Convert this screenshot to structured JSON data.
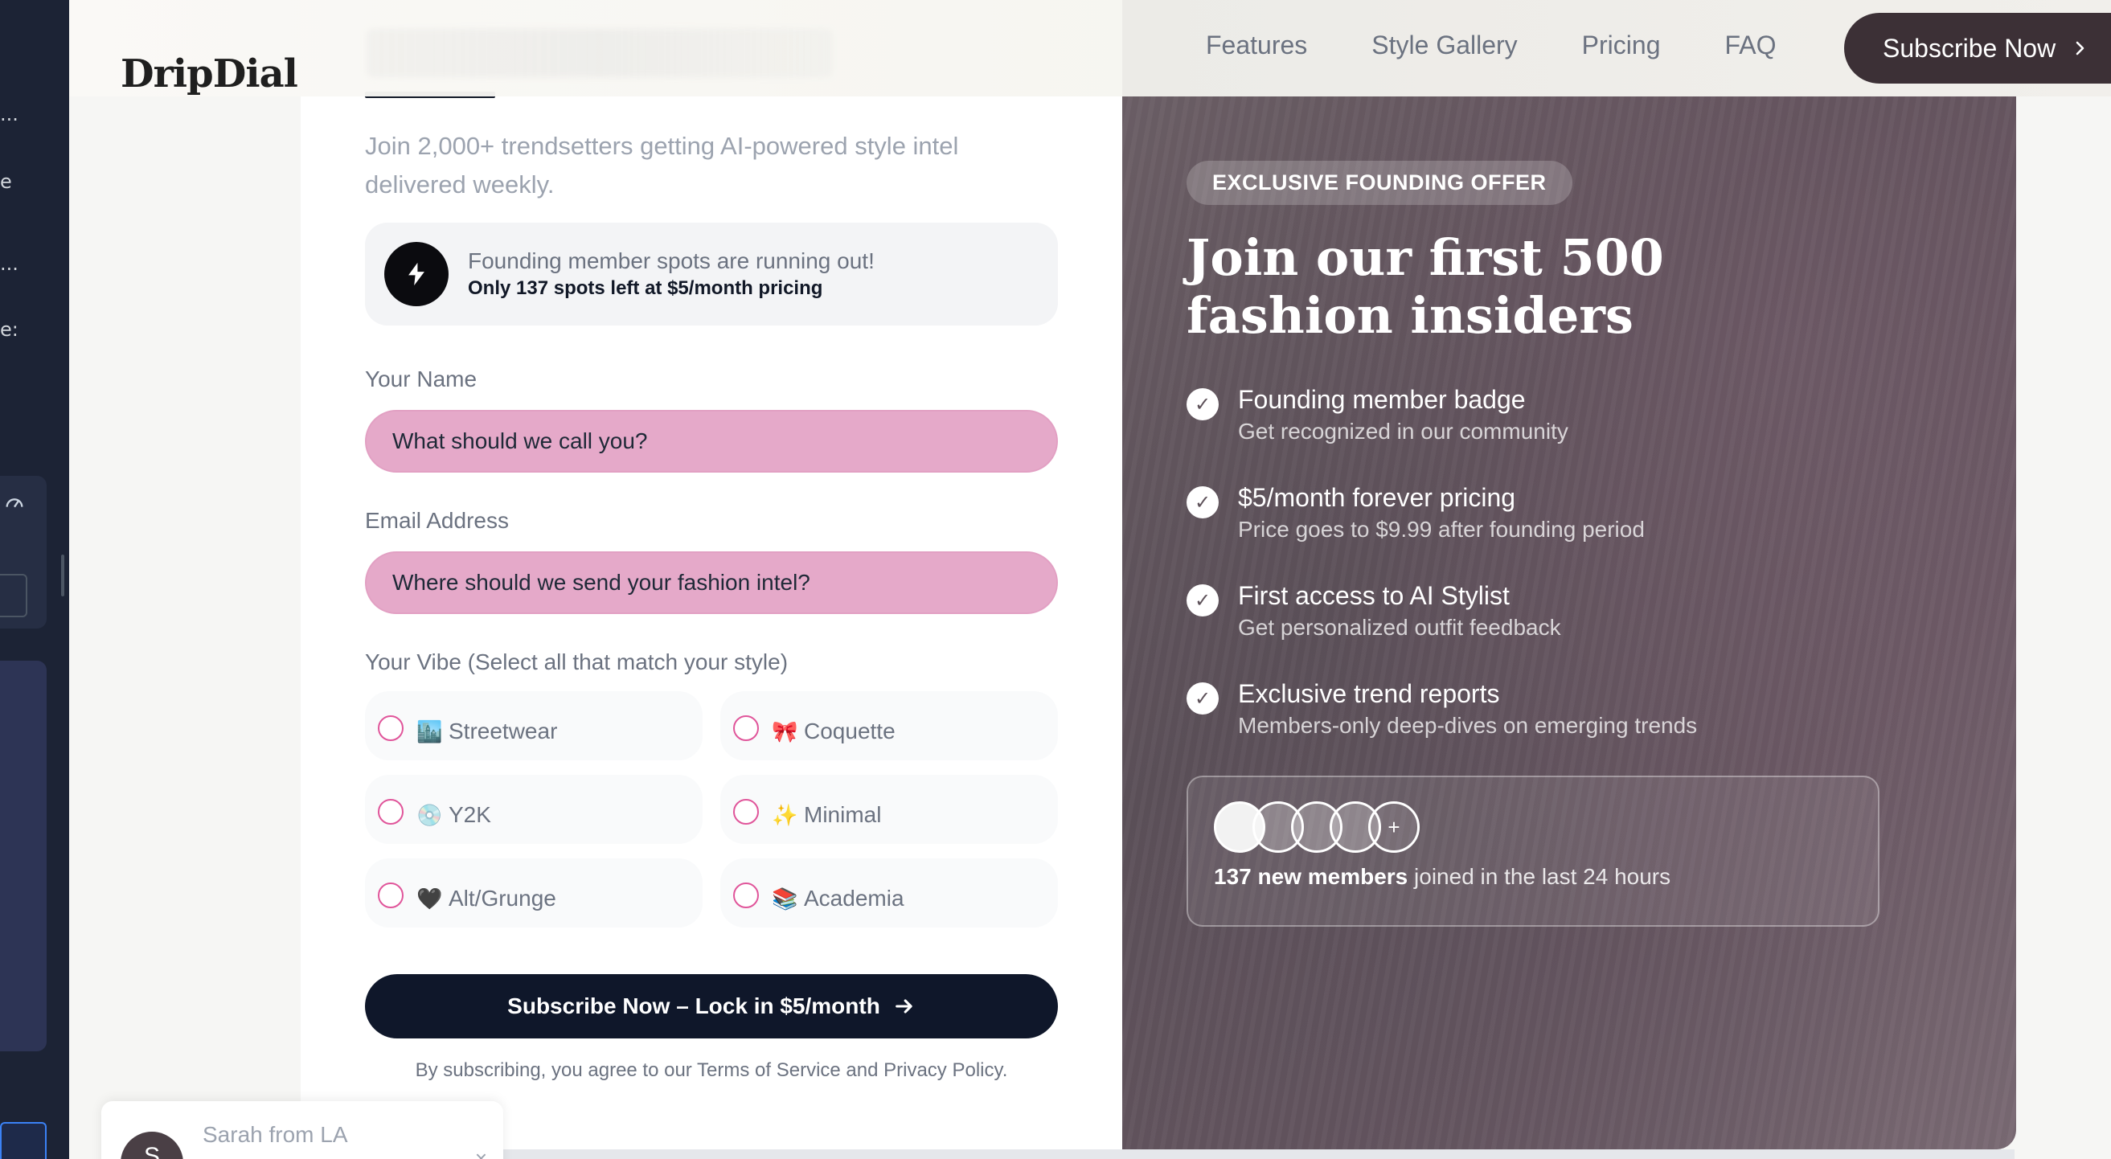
{
  "header": {
    "logo": "DripDial",
    "nav": [
      "Features",
      "Style Gallery",
      "Pricing",
      "FAQ"
    ],
    "cta_label": "Subscribe Now",
    "cta_icon": "chevron-right-icon"
  },
  "form": {
    "subtitle": "Join 2,000+ trendsetters getting AI-powered style intel delivered weekly.",
    "alert": {
      "icon": "lightning-bolt-icon",
      "line1": "Founding member spots are running out!",
      "line2": "Only 137 spots left at $5/month pricing"
    },
    "name_label": "Your Name",
    "name_placeholder": "What should we call you?",
    "email_label": "Email Address",
    "email_placeholder": "Where should we send your fashion intel?",
    "vibe_label": "Your Vibe (Select all that match your style)",
    "vibes": [
      {
        "emoji": "🏙️",
        "label": "Streetwear"
      },
      {
        "emoji": "🎀",
        "label": "Coquette"
      },
      {
        "emoji": "💿",
        "label": "Y2K"
      },
      {
        "emoji": "✨",
        "label": "Minimal"
      },
      {
        "emoji": "🖤",
        "label": "Alt/Grunge"
      },
      {
        "emoji": "📚",
        "label": "Academia"
      }
    ],
    "submit_label": "Subscribe Now – Lock in $5/month",
    "legal": "By subscribing, you agree to our Terms of Service and Privacy Policy."
  },
  "promo": {
    "badge": "EXCLUSIVE FOUNDING OFFER",
    "title_line1": "Join our first 500",
    "title_line2": "fashion insiders",
    "benefits": [
      {
        "title": "Founding member badge",
        "desc": "Get recognized in our community"
      },
      {
        "title": "$5/month forever pricing",
        "desc": "Price goes to $9.99 after founding period"
      },
      {
        "title": "First access to AI Stylist",
        "desc": "Get personalized outfit feedback"
      },
      {
        "title": "Exclusive trend reports",
        "desc": "Members-only deep-dives on emerging trends"
      }
    ],
    "members_count": "137 new members",
    "members_rest": " joined in the last 24 hours",
    "avatar_more": "+"
  },
  "toast": {
    "initial": "S",
    "name": "Sarah from LA",
    "close": "×"
  },
  "left_strip": {
    "fragments": [
      "...",
      "e",
      "...",
      "e:"
    ]
  },
  "colors": {
    "input_bg": "#e5a9c9",
    "radio_border": "#e0559a",
    "cta_bg": "#0f172a",
    "nav_cta_bg": "#3c3036",
    "promo_bg": "#5d5159"
  }
}
